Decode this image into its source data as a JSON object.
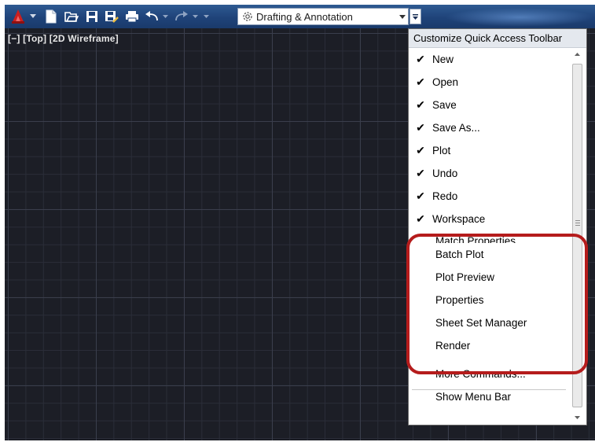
{
  "toolbar": {
    "workspace_label": "Drafting & Annotation",
    "colors": {
      "bar": "#1f4379",
      "app_icon": "#cc1f1f"
    }
  },
  "viewport": {
    "label": "[−] [Top] [2D Wireframe]"
  },
  "menu": {
    "header": "Customize Quick Access Toolbar",
    "checked_items": [
      {
        "label": "New",
        "checked": true
      },
      {
        "label": "Open",
        "checked": true
      },
      {
        "label": "Save",
        "checked": true
      },
      {
        "label": "Save As...",
        "checked": true
      },
      {
        "label": "Plot",
        "checked": true
      },
      {
        "label": "Undo",
        "checked": true
      },
      {
        "label": "Redo",
        "checked": true
      },
      {
        "label": "Workspace",
        "checked": true
      }
    ],
    "partial_item": "Match Properties",
    "unchecked_items": [
      {
        "label": "Batch Plot",
        "checked": false
      },
      {
        "label": "Plot Preview",
        "checked": false
      },
      {
        "label": "Properties",
        "checked": false
      },
      {
        "label": "Sheet Set Manager",
        "checked": false
      },
      {
        "label": "Render",
        "checked": false
      }
    ],
    "more_commands": "More Commands...",
    "show_menu_bar": "Show Menu Bar",
    "check_glyph": "✔",
    "highlight_color": "#b51c1c"
  }
}
